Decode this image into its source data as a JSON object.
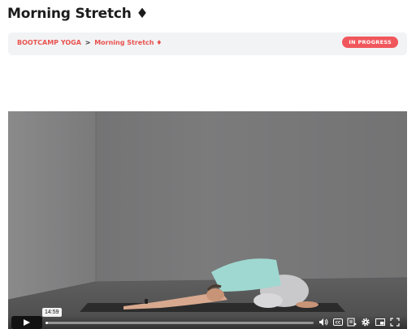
{
  "page": {
    "title": "Morning Stretch ♦"
  },
  "breadcrumb": {
    "parent": "BOOTCAMP YOGA",
    "separator": ">",
    "current": "Morning Stretch ♦"
  },
  "status": {
    "label": "IN PROGRESS",
    "color": "#f0575c"
  },
  "video": {
    "hover_time": "14:59",
    "progress_fraction": 0.01,
    "controls": [
      "play-icon",
      "volume-icon",
      "captions-icon",
      "transcript-icon",
      "settings-icon",
      "pip-icon",
      "fullscreen-icon"
    ]
  },
  "colors": {
    "accent": "#e8534f",
    "crumb_bg": "#f2f3f5"
  }
}
